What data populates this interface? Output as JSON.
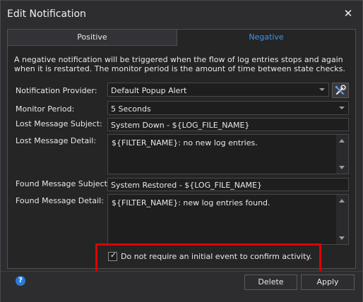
{
  "window": {
    "title": "Edit Notification",
    "close_glyph": "✕"
  },
  "tabs": [
    {
      "label": "Positive",
      "selected": false
    },
    {
      "label": "Negative",
      "selected": true
    }
  ],
  "description": "A negative notification will be triggered when the flow of log entries stops and again when it is restarted.  The monitor period is the amount of time between state checks.",
  "form": {
    "provider_label": "Notification Provider:",
    "provider_value": "Default Popup Alert",
    "monitor_label": "Monitor Period:",
    "monitor_value": "5 Seconds",
    "lost_subject_label": "Lost Message Subject:",
    "lost_subject_value": "System Down - ${LOG_FILE_NAME}",
    "lost_detail_label": "Lost Message Detail:",
    "lost_detail_value": "${FILTER_NAME}: no new log entries.",
    "found_subject_label": "Found Message Subject:",
    "found_subject_value": "System Restored - ${LOG_FILE_NAME}",
    "found_detail_label": "Found Message Detail:",
    "found_detail_value": "${FILTER_NAME}: new log entries found."
  },
  "checkbox": {
    "checked": true,
    "mark": "✓",
    "label": "Do not require an initial event to confirm activity."
  },
  "footer": {
    "help_glyph": "?",
    "delete_label": "Delete",
    "apply_label": "Apply"
  },
  "icons": {
    "close": "close-icon",
    "settings": "wrench-screwdriver-icon",
    "help": "help-icon",
    "dropdown": "chevron-down-icon"
  },
  "colors": {
    "accent_tab": "#3e95e6",
    "highlight_box": "#e00000",
    "help_icon": "#2b7bd4"
  }
}
